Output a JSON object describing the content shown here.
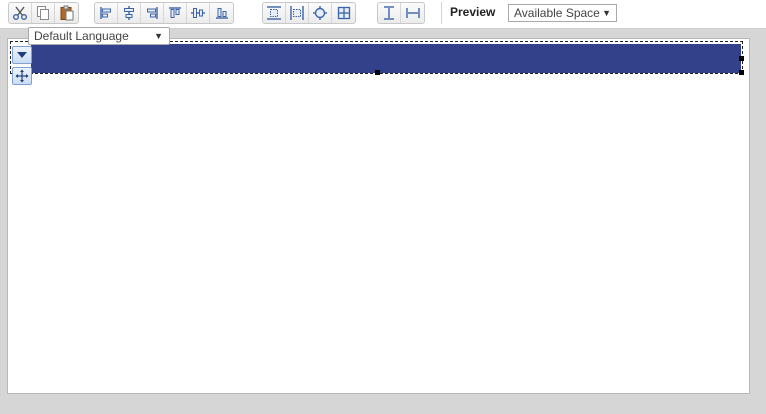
{
  "toolbar": {
    "groups": [
      [
        "cut-icon",
        "copy-icon",
        "paste-icon"
      ],
      [
        "align-left-icon",
        "align-center-icon",
        "align-right-icon",
        "align-top-icon",
        "align-middle-icon",
        "align-bottom-icon"
      ],
      [
        "fit-height-icon",
        "fit-width-icon",
        "fit-all-icon",
        "grid-icon"
      ],
      [
        "same-height-icon",
        "same-width-icon"
      ]
    ],
    "preview_label": "Preview",
    "preview_selected": "Available Space"
  },
  "language_select": {
    "selected": "Default Language"
  },
  "colors": {
    "bar": "#33408a",
    "canvas_bg": "#ffffff",
    "workspace_bg": "#d6d6d6"
  }
}
